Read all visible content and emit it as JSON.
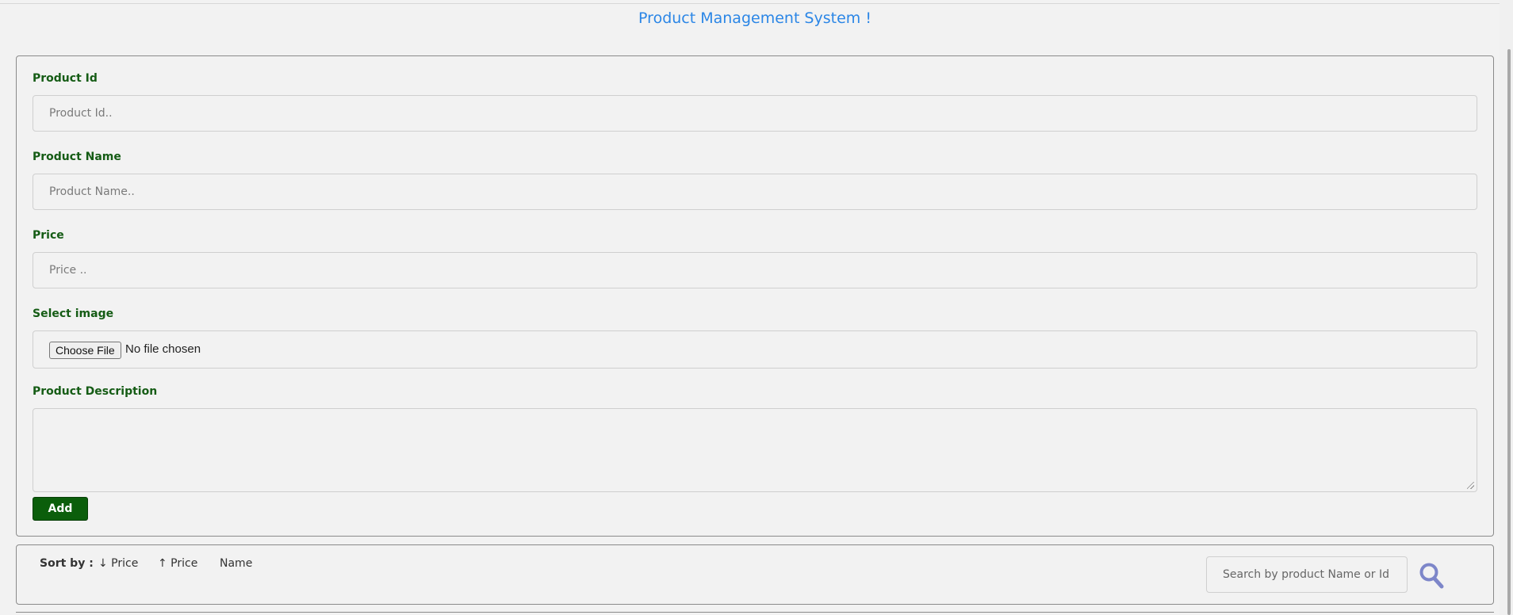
{
  "page": {
    "title": "Product Management System !"
  },
  "form": {
    "product_id": {
      "label": "Product Id",
      "placeholder": "Product Id..",
      "value": ""
    },
    "product_name": {
      "label": "Product Name",
      "placeholder": "Product Name..",
      "value": ""
    },
    "price": {
      "label": "Price",
      "placeholder": "Price ..",
      "value": ""
    },
    "image": {
      "label": "Select image",
      "button_label": "Choose File",
      "status": "No file chosen"
    },
    "description": {
      "label": "Product Description",
      "value": ""
    },
    "add_button": "Add"
  },
  "sort": {
    "label": "Sort by :",
    "options": [
      "↓ Price",
      "↑ Price",
      "Name"
    ]
  },
  "search": {
    "placeholder": "Search by product Name or Id ...",
    "icon": "search-icon"
  },
  "colors": {
    "title": "#2b86e6",
    "label": "#155c15",
    "add_button": "#0b5e0b",
    "search_icon": "#7d86c9"
  }
}
